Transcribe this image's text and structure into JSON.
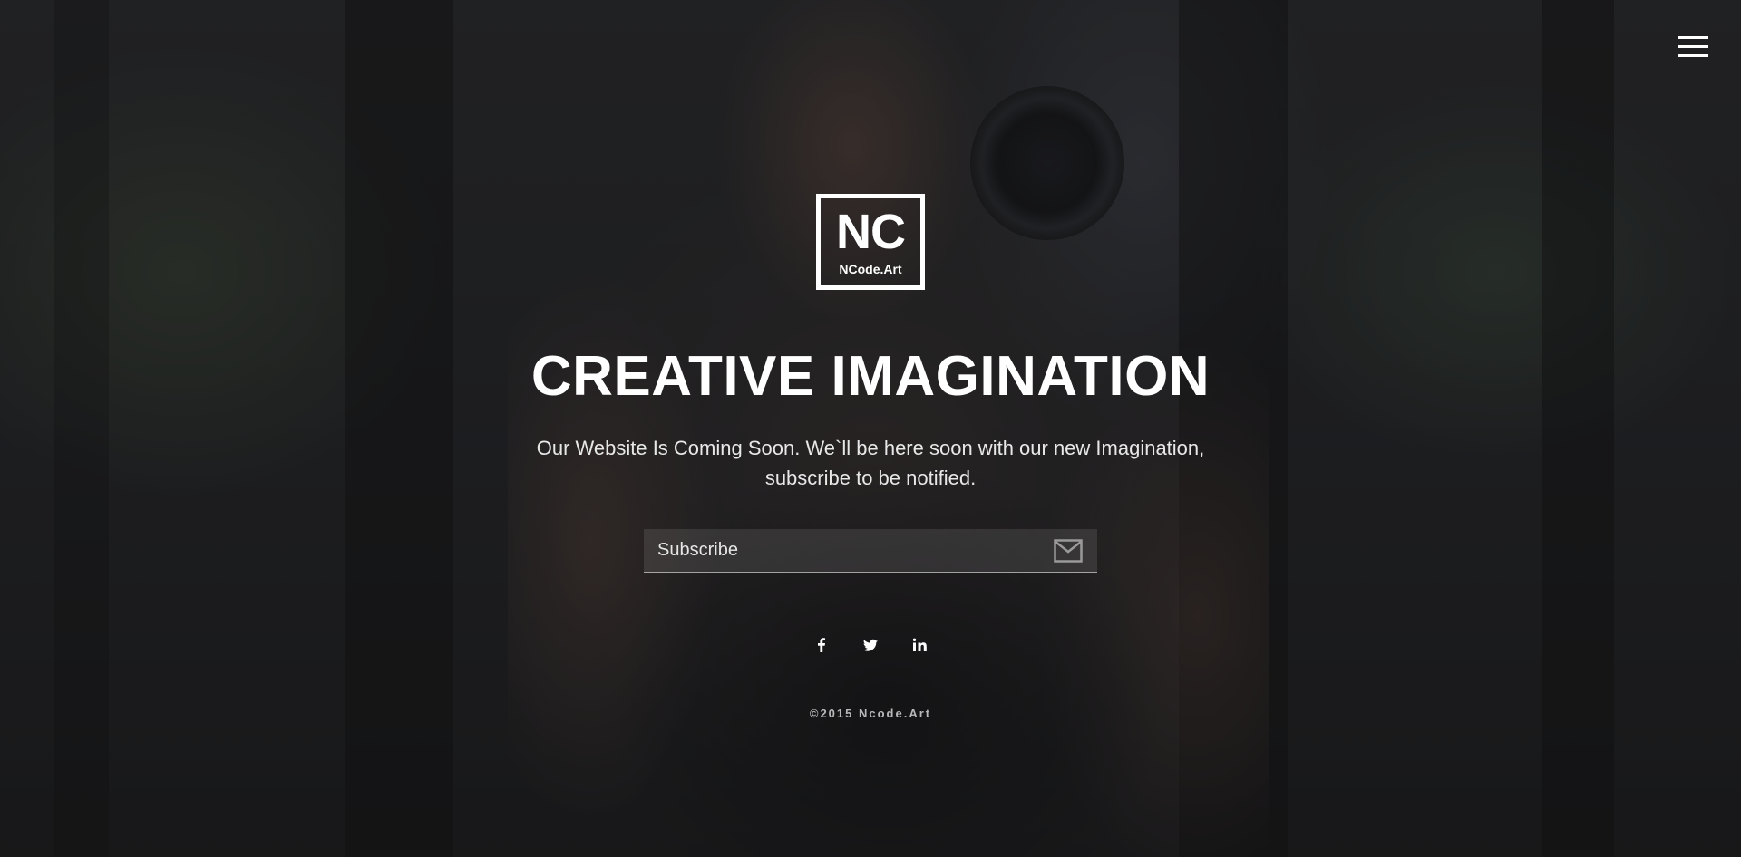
{
  "header": {
    "menu_icon": "hamburger-menu-icon"
  },
  "logo": {
    "mark": "NC",
    "name": "NCode.Art"
  },
  "hero": {
    "headline": "CREATIVE IMAGINATION",
    "tagline": "Our Website Is Coming Soon. We`ll be here soon with our new Imagination, subscribe to be notified."
  },
  "subscribe": {
    "placeholder": "Subscribe",
    "value": "",
    "icon": "envelope-icon"
  },
  "social": [
    {
      "name": "facebook",
      "icon": "facebook-icon"
    },
    {
      "name": "twitter",
      "icon": "twitter-icon"
    },
    {
      "name": "linkedin",
      "icon": "linkedin-icon"
    }
  ],
  "footer": {
    "copyright": "©2015 Ncode.Art"
  },
  "colors": {
    "text": "#ffffff",
    "overlay": "#1e1f21",
    "muted": "#b8b8b8"
  }
}
